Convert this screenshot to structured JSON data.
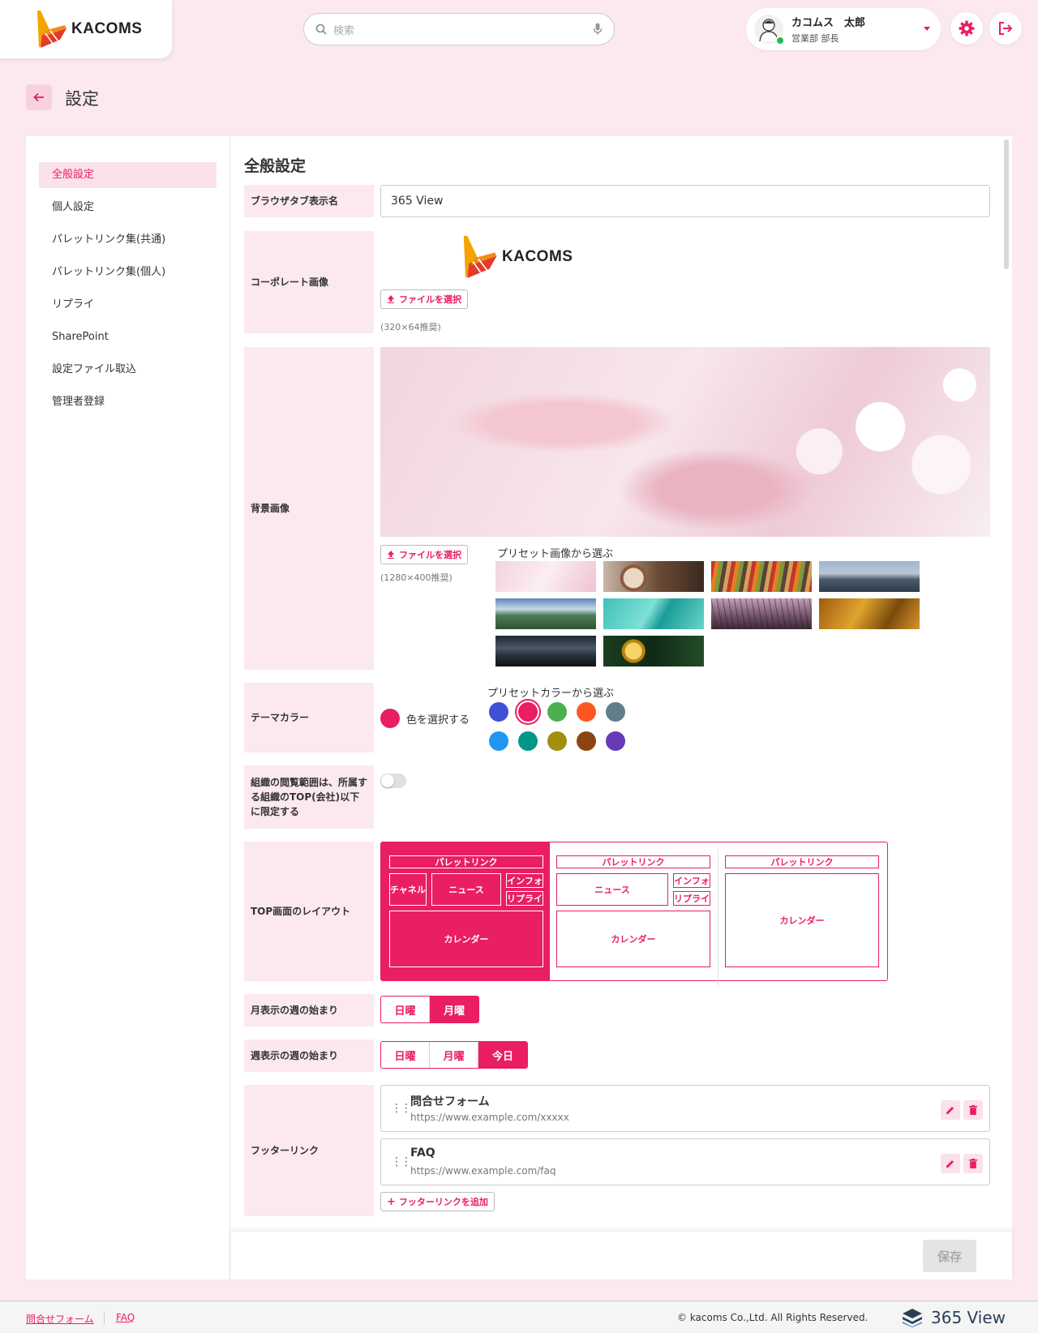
{
  "header": {
    "logo_text": "KACOMS",
    "search_placeholder": "検索",
    "user": {
      "name": "カコムス　太郎",
      "dept": "営業部 部長"
    }
  },
  "page": {
    "title": "設定"
  },
  "sidebar": {
    "items": [
      {
        "label": "全般設定",
        "active": true
      },
      {
        "label": "個人設定"
      },
      {
        "label": "パレットリンク集(共通)"
      },
      {
        "label": "パレットリンク集(個人)"
      },
      {
        "label": "リプライ"
      },
      {
        "label": "SharePoint"
      },
      {
        "label": "設定ファイル取込"
      },
      {
        "label": "管理者登録"
      }
    ]
  },
  "general": {
    "title": "全般設定",
    "browser_tab": {
      "label": "ブラウザタブ表示名",
      "value": "365 View"
    },
    "corporate": {
      "label": "コーポレート画像",
      "file_button": "ファイルを選択",
      "hint": "(320×64推奨)",
      "logo_text": "KACOMS"
    },
    "background": {
      "label": "背景画像",
      "file_button": "ファイルを選択",
      "hint": "(1280×400推奨)",
      "preset_label": "プリセット画像から選ぶ"
    },
    "theme": {
      "label": "テーマカラー",
      "choose_label": "色を選択する",
      "current": "#e91e63",
      "preset_label": "プリセットカラーから選ぶ",
      "presets": [
        "#3f51d6",
        "#e91e63",
        "#4caf50",
        "#ff5722",
        "#607d8b",
        "#2196f3",
        "#009688",
        "#a0900d",
        "#8b4513",
        "#673ab7"
      ],
      "selected_index": 1
    },
    "org_limit": {
      "label": "組織の閲覧範囲は、所属する組織のTOP(会社)以下に限定する",
      "on": false
    },
    "layout": {
      "label": "TOP画面のレイアウト",
      "palette": "パレットリンク",
      "channel": "チャネル",
      "news": "ニュース",
      "info": "インフォ",
      "reply": "リプライ",
      "calendar": "カレンダー"
    },
    "month_start": {
      "label": "月表示の週の始まり",
      "options": [
        "日曜",
        "月曜"
      ],
      "selected": 1
    },
    "week_start": {
      "label": "週表示の週の始まり",
      "options": [
        "日曜",
        "月曜",
        "今日"
      ],
      "selected": 2
    },
    "footer_links": {
      "label": "フッターリンク",
      "items": [
        {
          "title": "問合せフォーム",
          "url": "https://www.example.com/xxxxx"
        },
        {
          "title": "FAQ",
          "url": "https://www.example.com/faq"
        }
      ],
      "add_button": "フッターリンクを追加"
    },
    "save": "保存"
  },
  "footer": {
    "links": [
      "問合せフォーム",
      "FAQ"
    ],
    "copyright": "© kacoms Co.,Ltd. All Rights Reserved.",
    "product": "365 View"
  },
  "colors": {
    "accent": "#e91e63",
    "page_bg": "#fbe9ef"
  }
}
